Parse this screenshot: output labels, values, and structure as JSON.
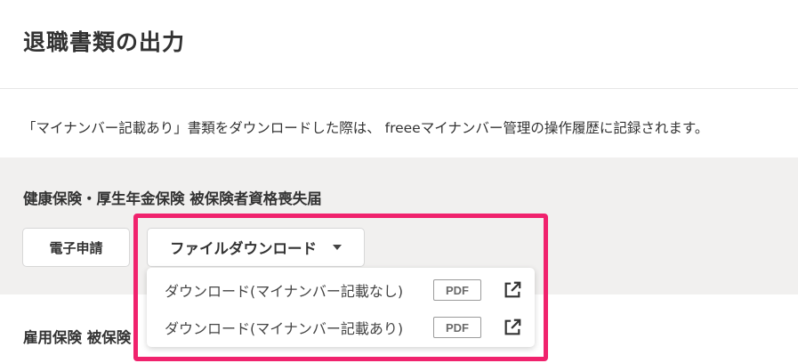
{
  "page": {
    "title": "退職書類の出力",
    "notice": "「マイナンバー記載あり」書類をダウンロードした際は、 freeeマイナンバー管理の操作履歴に記録されます。"
  },
  "sections": [
    {
      "title": "健康保険・厚生年金保険 被保険者資格喪失届",
      "e_filing_label": "電子申請",
      "download_label": "ファイルダウンロード"
    },
    {
      "title": "雇用保険 被保険"
    }
  ],
  "dropdown": {
    "items": [
      {
        "label": "ダウンロード(マイナンバー記載なし)",
        "badge": "PDF",
        "icon": "external-link-icon"
      },
      {
        "label": "ダウンロード(マイナンバー記載あり)",
        "badge": "PDF",
        "icon": "external-link-icon"
      }
    ]
  },
  "colors": {
    "highlight": "#f0226d",
    "band": "#f1f0ef"
  }
}
